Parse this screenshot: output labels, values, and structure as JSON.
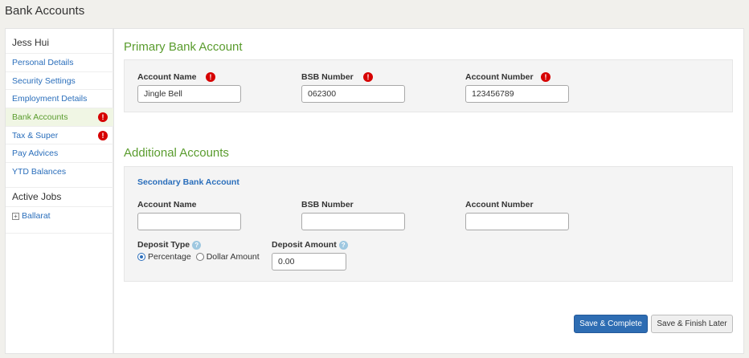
{
  "page": {
    "title": "Bank Accounts"
  },
  "sidebar": {
    "user_name": "Jess Hui",
    "items": [
      {
        "label": "Personal Details",
        "alert": false
      },
      {
        "label": "Security Settings",
        "alert": false
      },
      {
        "label": "Employment Details",
        "alert": false
      },
      {
        "label": "Bank Accounts",
        "alert": true,
        "active": true
      },
      {
        "label": "Tax & Super",
        "alert": true
      },
      {
        "label": "Pay Advices",
        "alert": false
      },
      {
        "label": "YTD Balances",
        "alert": false
      }
    ],
    "active_jobs": {
      "title": "Active Jobs",
      "expand_glyph": "+",
      "items": [
        {
          "label": "Ballarat"
        }
      ]
    }
  },
  "primary": {
    "title": "Primary Bank Account",
    "account_name": {
      "label": "Account Name",
      "value": "Jingle Bell"
    },
    "bsb_number": {
      "label": "BSB Number",
      "value": "062300"
    },
    "account_number": {
      "label": "Account Number",
      "value": "123456789"
    }
  },
  "additional": {
    "title": "Additional Accounts",
    "secondary": {
      "title": "Secondary Bank Account",
      "account_name": {
        "label": "Account Name",
        "value": ""
      },
      "bsb_number": {
        "label": "BSB Number",
        "value": ""
      },
      "account_number": {
        "label": "Account Number",
        "value": ""
      },
      "deposit_type": {
        "label": "Deposit Type",
        "options": [
          "Percentage",
          "Dollar Amount"
        ],
        "selected": "Percentage"
      },
      "deposit_amount": {
        "label": "Deposit Amount",
        "value": "0.00"
      }
    }
  },
  "icons": {
    "alert": "!",
    "help": "?"
  },
  "buttons": {
    "save_complete": "Save & Complete",
    "save_finish_later": "Save & Finish Later"
  },
  "colors": {
    "accent_green": "#5a9c2e",
    "link_blue": "#2a6ebb",
    "alert_red": "#d60000",
    "primary_button": "#2e6db3"
  }
}
